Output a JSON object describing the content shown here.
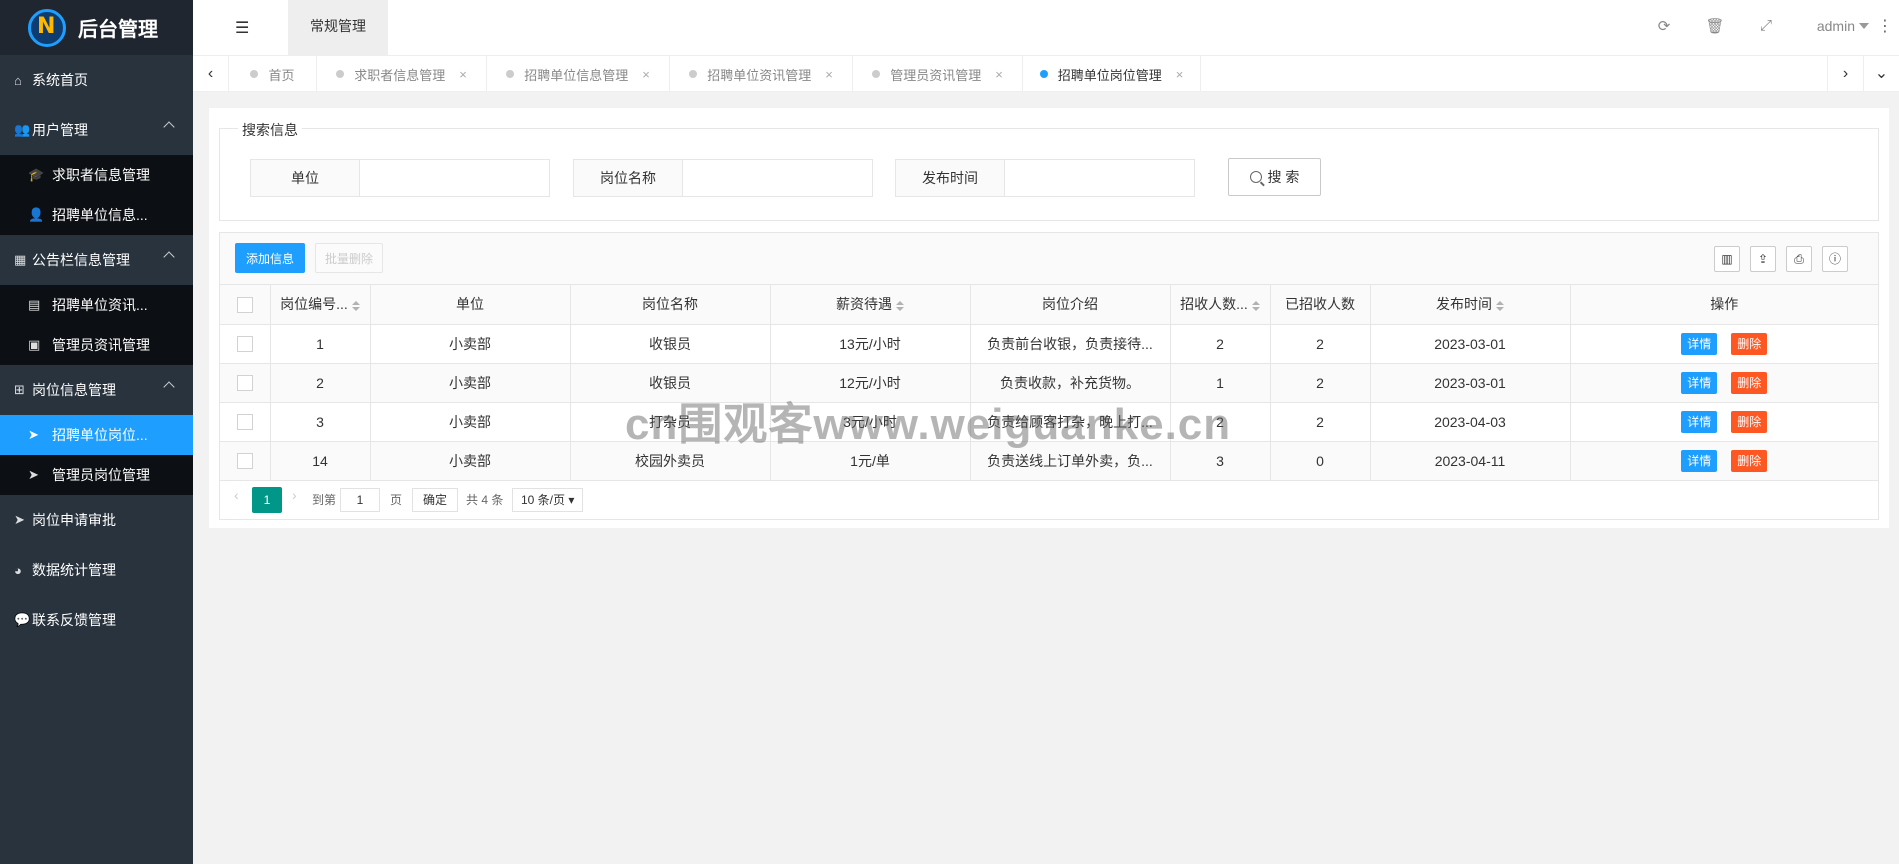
{
  "app": {
    "title": "后台管理",
    "logo_letter": "N"
  },
  "sidebar": {
    "items": [
      {
        "label": "系统首页",
        "icon": "home-icon",
        "glyph": "⌂"
      },
      {
        "label": "用户管理",
        "icon": "users-icon",
        "glyph": "👥",
        "expanded": true,
        "children": [
          {
            "label": "求职者信息管理",
            "glyph": "🎓"
          },
          {
            "label": "招聘单位信息...",
            "glyph": "👤"
          }
        ]
      },
      {
        "label": "公告栏信息管理",
        "icon": "calendar-icon",
        "glyph": "▦",
        "expanded": true,
        "children": [
          {
            "label": "招聘单位资讯...",
            "glyph": "▤"
          },
          {
            "label": "管理员资讯管理",
            "glyph": "▣"
          }
        ]
      },
      {
        "label": "岗位信息管理",
        "icon": "sitemap-icon",
        "glyph": "⊞",
        "expanded": true,
        "children": [
          {
            "label": "招聘单位岗位...",
            "glyph": "➤",
            "active": true
          },
          {
            "label": "管理员岗位管理",
            "glyph": "➤"
          }
        ]
      },
      {
        "label": "岗位申请审批",
        "icon": "send-icon",
        "glyph": "➤"
      },
      {
        "label": "数据统计管理",
        "icon": "pie-chart-icon",
        "glyph": "◕"
      },
      {
        "label": "联系反馈管理",
        "icon": "chat-icon",
        "glyph": "💬"
      }
    ]
  },
  "header": {
    "toggle_glyph": "☰",
    "tab_label": "常规管理",
    "user": "admin",
    "icons": {
      "refresh": "⟳",
      "trash": "🗑",
      "fullscreen": "⤢",
      "more": "⋮"
    }
  },
  "tabs": {
    "prev": "‹",
    "next": "›",
    "dropdown": "⌄",
    "items": [
      {
        "label": "首页",
        "closable": false
      },
      {
        "label": "求职者信息管理",
        "closable": true
      },
      {
        "label": "招聘单位信息管理",
        "closable": true
      },
      {
        "label": "招聘单位资讯管理",
        "closable": true
      },
      {
        "label": "管理员资讯管理",
        "closable": true
      },
      {
        "label": "招聘单位岗位管理",
        "closable": true,
        "active": true
      }
    ],
    "close_glyph": "×"
  },
  "search": {
    "legend": "搜索信息",
    "fields": [
      {
        "label": "单位",
        "value": ""
      },
      {
        "label": "岗位名称",
        "value": ""
      },
      {
        "label": "发布时间",
        "value": ""
      }
    ],
    "button": "搜 索"
  },
  "toolbar": {
    "add_label": "添加信息",
    "batch_delete_label": "批量删除",
    "icons": [
      "columns-icon",
      "export-icon",
      "print-icon",
      "info-icon"
    ],
    "icon_glyphs": [
      "▥",
      "⇪",
      "⎙",
      "ⓘ"
    ]
  },
  "table": {
    "columns": [
      "",
      "岗位编号...",
      "单位",
      "岗位名称",
      "薪资待遇",
      "岗位介绍",
      "招收人数...",
      "已招收人数",
      "发布时间",
      "操作"
    ],
    "rows": [
      {
        "id": "1",
        "unit": "小卖部",
        "name": "收银员",
        "salary": "13元/小时",
        "intro": "负责前台收银，负责接待...",
        "recruit": "2",
        "hired": "2",
        "date": "2023-03-01"
      },
      {
        "id": "2",
        "unit": "小卖部",
        "name": "收银员",
        "salary": "12元/小时",
        "intro": "负责收款，补充货物。",
        "recruit": "1",
        "hired": "2",
        "date": "2023-03-01"
      },
      {
        "id": "3",
        "unit": "小卖部",
        "name": "打杂员",
        "salary": "3元/小时",
        "intro": "负责给顾客打杂，晚上打...",
        "recruit": "2",
        "hired": "2",
        "date": "2023-04-03"
      },
      {
        "id": "14",
        "unit": "小卖部",
        "name": "校园外卖员",
        "salary": "1元/单",
        "intro": "负责送线上订单外卖，负...",
        "recruit": "3",
        "hired": "0",
        "date": "2023-04-11"
      }
    ],
    "detail_label": "详情",
    "delete_label": "删除"
  },
  "pager": {
    "current": "1",
    "goto_label": "到第",
    "page_input": "1",
    "page_suffix": "页",
    "ok_label": "确定",
    "total": "共 4 条",
    "page_size": "10 条/页"
  },
  "watermark": "cn围观客www.weiguanke.cn"
}
